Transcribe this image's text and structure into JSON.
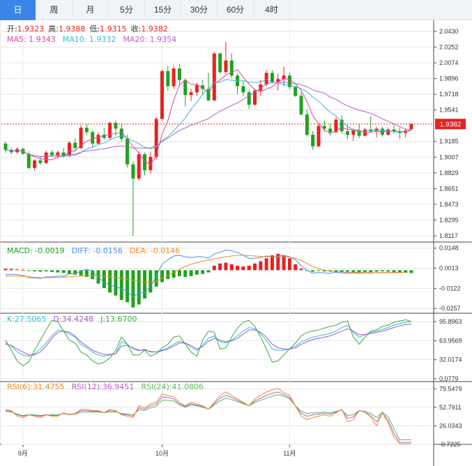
{
  "tabs": [
    {
      "label": "日",
      "active": true
    },
    {
      "label": "周",
      "active": false
    },
    {
      "label": "月",
      "active": false
    },
    {
      "label": "5分",
      "active": false
    },
    {
      "label": "15分",
      "active": false
    },
    {
      "label": "30分",
      "active": false
    },
    {
      "label": "60分",
      "active": false
    },
    {
      "label": "4时",
      "active": false
    }
  ],
  "ohlc_info": {
    "open_label": "开:",
    "open": "1.9323",
    "high_label": "高:",
    "high": "1.9388",
    "low_label": "低:",
    "low": "1.9315",
    "close_label": "收:",
    "close": "1.9382"
  },
  "ma_info": {
    "ma5": "MA5: 1.9343",
    "ma10": "MA10: 1.9332",
    "ma20": "MA20: 1.9354"
  },
  "macd_info": {
    "macd": "MACD: -0.0019",
    "diff": "DIFF: -0.0156",
    "dea": "DEA: -0.0146"
  },
  "kdj_info": {
    "k": "K:27.5065",
    "d": "D:34.4248",
    "j": "J:13.6700"
  },
  "rsi_info": {
    "rsi6": "RSI(6):31.4755",
    "rsi12": "RSI(12):36.9451",
    "rsi24": "RSI(24):41.0806"
  },
  "current_price": "1.9382",
  "colors": {
    "up": "#e8221f",
    "down": "#1fa31f",
    "ma5": "#e040a0",
    "ma10": "#33bcd6",
    "ma20": "#b560c8",
    "diff": "#4a90e2",
    "dea": "#f08a24",
    "k": "#33bcd6",
    "d": "#9a5ad0",
    "j": "#3aa83a",
    "rsi6": "#f08a24",
    "rsi12": "#b560c8",
    "rsi24": "#5cb85c",
    "price_line": "#e8221f"
  },
  "chart_data": {
    "type": "candlestick",
    "x_labels": [
      {
        "label": "9月",
        "index": 3
      },
      {
        "label": "10月",
        "index": 27
      },
      {
        "label": "11月",
        "index": 49
      }
    ],
    "candles": [
      [
        1.9161,
        1.9184,
        1.9055,
        1.909
      ],
      [
        1.909,
        1.911,
        1.904,
        1.9062
      ],
      [
        1.9062,
        1.912,
        1.905,
        1.91
      ],
      [
        1.91,
        1.9115,
        1.903,
        1.9045
      ],
      [
        1.9045,
        1.907,
        1.887,
        1.8885
      ],
      [
        1.8885,
        1.8985,
        1.886,
        1.897
      ],
      [
        1.897,
        1.901,
        1.892,
        1.894
      ],
      [
        1.894,
        1.908,
        1.893,
        1.906
      ],
      [
        1.906,
        1.909,
        1.901,
        1.903
      ],
      [
        1.903,
        1.908,
        1.899,
        1.906
      ],
      [
        1.906,
        1.911,
        1.9,
        1.902
      ],
      [
        1.902,
        1.919,
        1.901,
        1.917
      ],
      [
        1.917,
        1.922,
        1.908,
        1.911
      ],
      [
        1.911,
        1.937,
        1.91,
        1.934
      ],
      [
        1.934,
        1.938,
        1.926,
        1.929
      ],
      [
        1.929,
        1.931,
        1.911,
        1.916
      ],
      [
        1.916,
        1.929,
        1.915,
        1.926
      ],
      [
        1.926,
        1.934,
        1.92,
        1.9225
      ],
      [
        1.9225,
        1.941,
        1.921,
        1.9395
      ],
      [
        1.9395,
        1.942,
        1.925,
        1.933
      ],
      [
        1.933,
        1.938,
        1.918,
        1.9215
      ],
      [
        1.9215,
        1.926,
        1.889,
        1.8925
      ],
      [
        1.8925,
        1.896,
        1.8117,
        1.8765
      ],
      [
        1.8765,
        1.907,
        1.874,
        1.904
      ],
      [
        1.904,
        1.906,
        1.88,
        1.886
      ],
      [
        1.886,
        1.907,
        1.882,
        1.901
      ],
      [
        1.901,
        1.946,
        1.898,
        1.944
      ],
      [
        1.944,
        2.0,
        1.942,
        1.998
      ],
      [
        1.998,
        2.004,
        1.976,
        1.981
      ],
      [
        1.981,
        2.004,
        1.978,
        2.001
      ],
      [
        2.001,
        2.006,
        1.981,
        1.988
      ],
      [
        1.988,
        1.99,
        1.958,
        1.971
      ],
      [
        1.971,
        1.978,
        1.964,
        1.974
      ],
      [
        1.974,
        1.985,
        1.97,
        1.982
      ],
      [
        1.982,
        1.988,
        1.972,
        1.978
      ],
      [
        1.978,
        1.996,
        1.964,
        1.965
      ],
      [
        1.965,
        2.02,
        1.964,
        2.018
      ],
      [
        2.018,
        2.019,
        1.995,
        1.997
      ],
      [
        1.997,
        2.031,
        1.995,
        2.01
      ],
      [
        2.01,
        2.018,
        1.99,
        1.993
      ],
      [
        1.993,
        1.996,
        1.972,
        1.981
      ],
      [
        1.981,
        1.987,
        1.97,
        1.974
      ],
      [
        1.974,
        1.977,
        1.955,
        1.96
      ],
      [
        1.96,
        1.978,
        1.959,
        1.976
      ],
      [
        1.976,
        1.988,
        1.97,
        1.983
      ],
      [
        1.983,
        1.999,
        1.981,
        1.996
      ],
      [
        1.996,
        1.999,
        1.984,
        1.986
      ],
      [
        1.986,
        1.995,
        1.976,
        1.989
      ],
      [
        1.989,
        2.003,
        1.981,
        1.993
      ],
      [
        1.993,
        1.996,
        1.977,
        1.98
      ],
      [
        1.98,
        1.981,
        1.969,
        1.97
      ],
      [
        1.97,
        1.974,
        1.948,
        1.949
      ],
      [
        1.949,
        1.955,
        1.924,
        1.926
      ],
      [
        1.926,
        1.93,
        1.909,
        1.913
      ],
      [
        1.913,
        1.938,
        1.912,
        1.936
      ],
      [
        1.936,
        1.942,
        1.929,
        1.933
      ],
      [
        1.933,
        1.938,
        1.925,
        1.929
      ],
      [
        1.929,
        1.946,
        1.928,
        1.943
      ],
      [
        1.943,
        1.948,
        1.927,
        1.93
      ],
      [
        1.93,
        1.937,
        1.921,
        1.926
      ],
      [
        1.926,
        1.933,
        1.919,
        1.931
      ],
      [
        1.931,
        1.938,
        1.922,
        1.925
      ],
      [
        1.925,
        1.934,
        1.924,
        1.932
      ],
      [
        1.932,
        1.947,
        1.929,
        1.93
      ],
      [
        1.93,
        1.935,
        1.923,
        1.933
      ],
      [
        1.933,
        1.935,
        1.924,
        1.926
      ],
      [
        1.926,
        1.934,
        1.925,
        1.932
      ],
      [
        1.932,
        1.937,
        1.927,
        1.93
      ],
      [
        1.93,
        1.934,
        1.921,
        1.928
      ],
      [
        1.928,
        1.933,
        1.923,
        1.931
      ],
      [
        1.9323,
        1.9388,
        1.9315,
        1.9382
      ]
    ],
    "y_ticks": [
      "2.0430",
      "2.0252",
      "2.0074",
      "1.9896",
      "1.9718",
      "1.9541",
      "1.9185",
      "1.9007",
      "1.8829",
      "1.8651",
      "1.8473",
      "1.8295",
      "1.8117"
    ],
    "ylim": [
      1.8117,
      2.043
    ],
    "macd": {
      "y_ticks": [
        "0.0148",
        "0.0013",
        "-0.0122",
        "-0.0257"
      ],
      "ylim": [
        -0.027,
        0.017
      ],
      "hist": [
        0.001,
        0.0008,
        0.0005,
        0.0003,
        -0.0005,
        -0.0008,
        -0.001,
        -0.0008,
        -0.0012,
        -0.0015,
        -0.0018,
        -0.0025,
        -0.003,
        -0.0035,
        -0.0045,
        -0.006,
        -0.009,
        -0.012,
        -0.015,
        -0.017,
        -0.02,
        -0.0215,
        -0.025,
        -0.023,
        -0.019,
        -0.015,
        -0.011,
        -0.008,
        -0.006,
        -0.005,
        -0.004,
        -0.0045,
        -0.004,
        -0.003,
        -0.0025,
        -0.0015,
        0.003,
        0.0045,
        0.005,
        0.004,
        0.003,
        0.0025,
        0.003,
        0.0045,
        0.006,
        0.008,
        0.01,
        0.011,
        0.01,
        0.008,
        0.004,
        0.001,
        -0.0005,
        -0.001,
        -0.0005,
        -0.0008,
        -0.0006,
        -0.001,
        -0.0012,
        -0.001,
        -0.0012,
        -0.0014,
        -0.0012,
        -0.0013,
        -0.001,
        -0.0008,
        -0.001,
        -0.0012,
        -0.0015,
        -0.0017,
        -0.0019
      ],
      "diff": [
        -0.003,
        -0.0028,
        -0.003,
        -0.0035,
        -0.005,
        -0.0052,
        -0.0055,
        -0.0045,
        -0.0045,
        -0.004,
        -0.004,
        -0.0025,
        -0.0025,
        -0.0005,
        0.0005,
        -0.0005,
        -0.005,
        -0.008,
        -0.01,
        -0.011,
        -0.0125,
        -0.014,
        -0.018,
        -0.015,
        -0.015,
        -0.011,
        -0.004,
        0.004,
        0.007,
        0.0095,
        0.01,
        0.009,
        0.0085,
        0.009,
        0.009,
        0.008,
        0.011,
        0.012,
        0.0135,
        0.013,
        0.012,
        0.01,
        0.008,
        0.008,
        0.0085,
        0.0095,
        0.009,
        0.0095,
        0.01,
        0.009,
        0.007,
        0.003,
        0.0,
        -0.002,
        -0.0015,
        -0.0018,
        -0.002,
        -0.0015,
        -0.0018,
        -0.002,
        -0.0018,
        -0.0022,
        -0.0018,
        -0.002,
        -0.0016,
        -0.0018,
        -0.0016,
        -0.0017,
        -0.0016,
        -0.0015,
        -0.0016
      ],
      "dea": [
        -0.004,
        -0.004,
        -0.004,
        -0.0042,
        -0.0045,
        -0.0048,
        -0.005,
        -0.005,
        -0.005,
        -0.0048,
        -0.0047,
        -0.0045,
        -0.0042,
        -0.004,
        -0.0038,
        -0.0036,
        -0.0036,
        -0.004,
        -0.0045,
        -0.005,
        -0.0055,
        -0.006,
        -0.0068,
        -0.0075,
        -0.008,
        -0.0082,
        -0.0075,
        -0.0055,
        -0.0035,
        -0.0015,
        0.0005,
        0.0025,
        0.004,
        0.005,
        0.006,
        0.0068,
        0.0075,
        0.0082,
        0.009,
        0.0095,
        0.01,
        0.01,
        0.0098,
        0.0095,
        0.0092,
        0.009,
        0.009,
        0.009,
        0.009,
        0.0088,
        0.008,
        0.0065,
        0.0045,
        0.0025,
        0.001,
        0.0,
        -0.0008,
        -0.001,
        -0.0012,
        -0.0014,
        -0.0015,
        -0.0016,
        -0.0016,
        -0.0017,
        -0.0016,
        -0.0016,
        -0.0016,
        -0.0015,
        -0.0015,
        -0.0015,
        -0.0146
      ]
    },
    "kdj": {
      "y_ticks": [
        "95.8963",
        "63.9569",
        "32.0174",
        "0.0779"
      ],
      "ylim": [
        0.0779,
        110
      ],
      "k": [
        60,
        55,
        45,
        40,
        38,
        42,
        50,
        60,
        72,
        82,
        80,
        75,
        70,
        58,
        52,
        45,
        40,
        38,
        40,
        42,
        62,
        58,
        50,
        47,
        50,
        45,
        45,
        48,
        52,
        58,
        63,
        60,
        53,
        47,
        57,
        68,
        72,
        62,
        60,
        65,
        72,
        80,
        86,
        84,
        75,
        65,
        50,
        48,
        48,
        50,
        55,
        62,
        66,
        70,
        72,
        74,
        76,
        80,
        86,
        90,
        78,
        70,
        74,
        78,
        80,
        83,
        86,
        90,
        93,
        95,
        96
      ],
      "d": [
        58,
        56,
        50,
        45,
        40,
        40,
        45,
        55,
        68,
        78,
        80,
        78,
        72,
        62,
        55,
        48,
        44,
        41,
        41,
        42,
        55,
        56,
        52,
        48,
        48,
        46,
        45,
        47,
        50,
        55,
        60,
        60,
        56,
        50,
        54,
        63,
        68,
        65,
        62,
        64,
        68,
        75,
        82,
        82,
        78,
        70,
        58,
        52,
        50,
        50,
        52,
        58,
        62,
        66,
        68,
        70,
        72,
        76,
        80,
        84,
        80,
        74,
        74,
        76,
        78,
        80,
        83,
        86,
        89,
        91,
        92
      ],
      "j": [
        65,
        48,
        30,
        22,
        28,
        48,
        65,
        82,
        98,
        96,
        80,
        65,
        60,
        45,
        40,
        30,
        25,
        28,
        35,
        48,
        70,
        58,
        40,
        40,
        48,
        38,
        42,
        52,
        58,
        70,
        72,
        58,
        45,
        38,
        65,
        80,
        78,
        50,
        52,
        70,
        85,
        95,
        98,
        88,
        70,
        50,
        28,
        30,
        40,
        50,
        60,
        72,
        78,
        80,
        82,
        85,
        88,
        90,
        95,
        97,
        70,
        58,
        70,
        80,
        82,
        88,
        90,
        95,
        97,
        99,
        96
      ]
    },
    "rsi": {
      "y_ticks": [
        "79.5479",
        "52.7911",
        "26.0343",
        "-0.7225"
      ],
      "ylim": [
        -0.7225,
        90
      ],
      "rsi6": [
        50,
        48,
        40,
        38,
        42,
        40,
        38,
        42,
        40,
        40,
        45,
        42,
        44,
        50,
        50,
        48,
        48,
        45,
        50,
        48,
        42,
        40,
        38,
        55,
        52,
        58,
        60,
        72,
        70,
        68,
        60,
        55,
        60,
        58,
        55,
        50,
        60,
        70,
        75,
        70,
        65,
        60,
        55,
        65,
        70,
        75,
        78,
        80,
        74,
        70,
        55,
        40,
        35,
        38,
        40,
        42,
        40,
        45,
        50,
        32,
        35,
        48,
        46,
        38,
        26,
        45,
        30,
        10,
        0,
        0,
        0
      ],
      "rsi12": [
        48,
        47,
        42,
        40,
        42,
        41,
        40,
        42,
        41,
        41,
        44,
        42,
        43,
        48,
        48,
        47,
        47,
        45,
        48,
        47,
        43,
        42,
        40,
        52,
        50,
        55,
        57,
        68,
        67,
        65,
        58,
        54,
        58,
        56,
        54,
        50,
        58,
        66,
        70,
        67,
        63,
        59,
        55,
        62,
        66,
        70,
        73,
        75,
        71,
        67,
        55,
        44,
        40,
        42,
        43,
        44,
        43,
        46,
        49,
        37,
        39,
        48,
        46,
        41,
        32,
        45,
        34,
        15,
        2,
        2,
        2
      ],
      "rsi24": [
        47,
        46,
        43,
        41,
        42,
        42,
        41,
        42,
        42,
        42,
        44,
        43,
        43,
        46,
        46,
        46,
        46,
        45,
        46,
        46,
        44,
        43,
        42,
        49,
        48,
        52,
        54,
        63,
        63,
        62,
        56,
        53,
        56,
        55,
        53,
        50,
        56,
        62,
        66,
        64,
        61,
        58,
        55,
        60,
        63,
        66,
        69,
        71,
        69,
        65,
        55,
        47,
        44,
        45,
        45,
        46,
        45,
        47,
        49,
        41,
        42,
        48,
        47,
        44,
        38,
        46,
        39,
        22,
        6,
        6,
        6
      ]
    }
  }
}
